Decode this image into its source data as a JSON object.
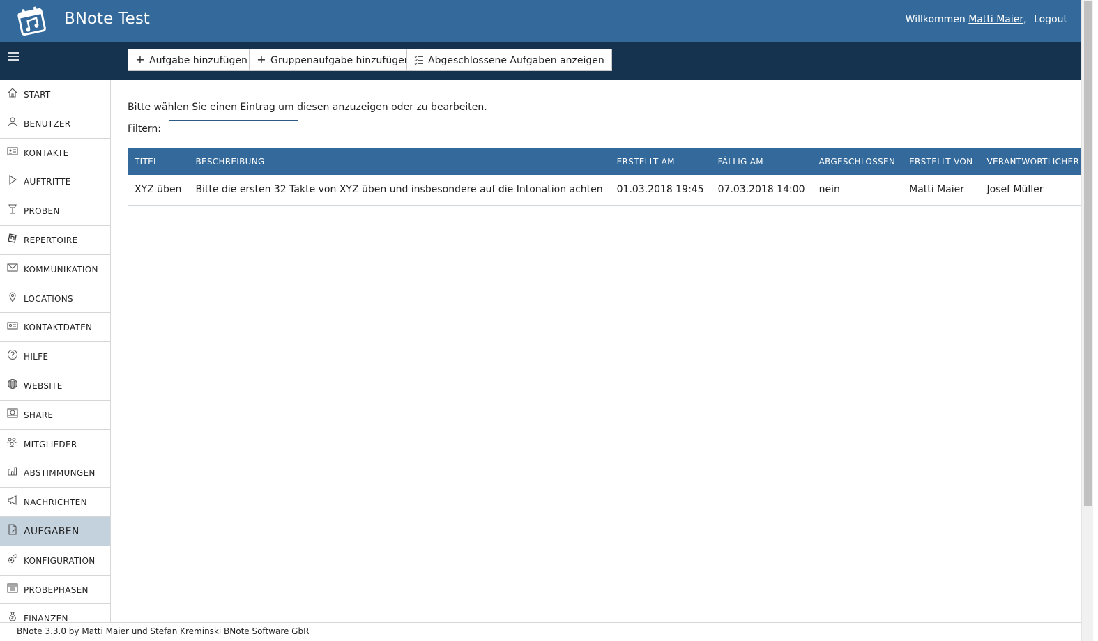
{
  "header": {
    "app_title": "BNote Test",
    "welcome_text": "Willkommen",
    "user_name": "Matti Maier",
    "user_separator": ",",
    "logout_label": "Logout",
    "bg_color": "#346a9b"
  },
  "toolbar": {
    "bg_color": "#15324e",
    "buttons": [
      {
        "label": "Aufgabe hinzufügen",
        "icon": "plus-icon"
      },
      {
        "label": "Gruppenaufgabe hinzufügen",
        "icon": "plus-icon"
      },
      {
        "label": "Abgeschlossene Aufgaben anzeigen",
        "icon": "checklist-icon"
      }
    ]
  },
  "sidebar": {
    "items": [
      {
        "label": "START",
        "icon": "home-icon"
      },
      {
        "label": "BENUTZER",
        "icon": "user-icon"
      },
      {
        "label": "KONTAKTE",
        "icon": "contact-card-icon"
      },
      {
        "label": "AUFTRITTE",
        "icon": "play-icon"
      },
      {
        "label": "PROBEN",
        "icon": "music-stand-icon"
      },
      {
        "label": "REPERTOIRE",
        "icon": "sheet-music-icon"
      },
      {
        "label": "KOMMUNIKATION",
        "icon": "envelope-icon"
      },
      {
        "label": "LOCATIONS",
        "icon": "map-pin-icon"
      },
      {
        "label": "KONTAKTDATEN",
        "icon": "id-card-icon"
      },
      {
        "label": "HILFE",
        "icon": "help-circle-icon"
      },
      {
        "label": "WEBSITE",
        "icon": "globe-icon"
      },
      {
        "label": "SHARE",
        "icon": "share-drive-icon"
      },
      {
        "label": "MITGLIEDER",
        "icon": "members-icon"
      },
      {
        "label": "ABSTIMMUNGEN",
        "icon": "bar-chart-icon"
      },
      {
        "label": "NACHRICHTEN",
        "icon": "megaphone-icon"
      },
      {
        "label": "AUFGABEN",
        "icon": "task-document-icon",
        "active": true
      },
      {
        "label": "KONFIGURATION",
        "icon": "gears-icon"
      },
      {
        "label": "PROBEPHASEN",
        "icon": "calendar-list-icon"
      },
      {
        "label": "FINANZEN",
        "icon": "money-bag-icon"
      }
    ],
    "active_color": "#c4d2de"
  },
  "main": {
    "intro_text": "Bitte wählen Sie einen Eintrag um diesen anzuzeigen oder zu bearbeiten.",
    "filter_label": "Filtern:",
    "filter_value": "",
    "table": {
      "columns": [
        "TITEL",
        "BESCHREIBUNG",
        "ERSTELLT AM",
        "FÄLLIG AM",
        "ABGESCHLOSSEN",
        "ERSTELLT VON",
        "VERANTWORTLICHER"
      ],
      "rows": [
        [
          "XYZ üben",
          "Bitte die ersten 32 Takte von XYZ üben und insbesondere auf die Intonation achten",
          "01.03.2018 19:45",
          "07.03.2018 14:00",
          "nein",
          "Matti Maier",
          "Josef Müller"
        ]
      ]
    }
  },
  "footer": {
    "text": "BNote 3.3.0 by Matti Maier und Stefan Kreminski BNote Software GbR"
  }
}
